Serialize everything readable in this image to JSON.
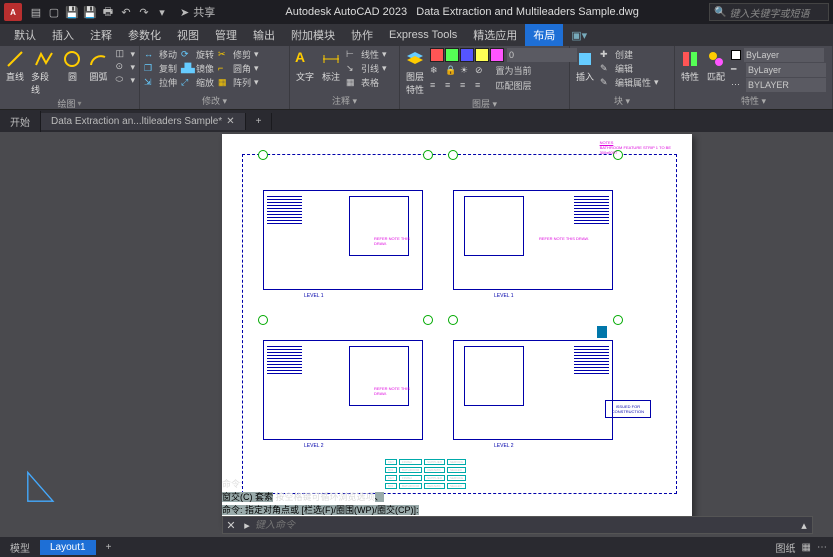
{
  "app": {
    "title_left": "Autodesk AutoCAD 2023",
    "title_right": "Data Extraction and Multileaders Sample.dwg"
  },
  "qat": {
    "share": "共享"
  },
  "search": {
    "placeholder": "键入关键字或短语"
  },
  "menu": [
    "默认",
    "插入",
    "注释",
    "参数化",
    "视图",
    "管理",
    "输出",
    "附加模块",
    "协作",
    "Express Tools",
    "精选应用",
    "布局"
  ],
  "ribbon": {
    "draw": {
      "label": "绘图",
      "btns": [
        "直线",
        "多段线",
        "圆",
        "圆弧"
      ]
    },
    "modify": {
      "label": "修改 ▾",
      "col1": [
        "移动",
        "复制",
        "拉伸"
      ],
      "col2": [
        "旋转",
        "镜像",
        "缩放"
      ],
      "col3": [
        "修剪",
        "圆角",
        "阵列"
      ]
    },
    "annot": {
      "label": "注释 ▾",
      "big": [
        "文字",
        "标注"
      ],
      "rows": [
        "引线",
        "表格"
      ],
      "linetype": "线性"
    },
    "layers": {
      "label": "图层 ▾",
      "big": "图层\n特性",
      "rows": [
        "置为当前",
        "匹配图层"
      ],
      "dd": "0"
    },
    "block": {
      "label": "块 ▾",
      "big": "插入",
      "rows": [
        "创建",
        "编辑",
        "编辑属性"
      ]
    },
    "props": {
      "label": "特性 ▾",
      "big": "特性",
      "combo1": "ByLayer",
      "combo2": "ByLayer",
      "combo3": "BYLAYER",
      "match": "匹配"
    }
  },
  "tabs": {
    "start": "开始",
    "file": "Data Extraction an...ltileaders Sample*"
  },
  "drawing": {
    "level1": "LEVEL 1",
    "level2": "LEVEL 2",
    "notes_title": "NOTES",
    "stamp1": "ISSUED FOR",
    "stamp2": "CONSTRUCTION",
    "leader": "REFER NOTE THIS DRAW."
  },
  "cmd": {
    "line1": "命令:",
    "line2_a": "窗交(C) 套索",
    "line2_b": " 按空格键可循环浏览选项",
    "line2_c": "、",
    "line3": "命令: 指定对角点或 [栏选(F)/圈围(WP)/圈交(CP)]:",
    "placeholder": "键入命令"
  },
  "bottom": {
    "model": "模型",
    "layout": "Layout1",
    "paper": "图纸"
  }
}
